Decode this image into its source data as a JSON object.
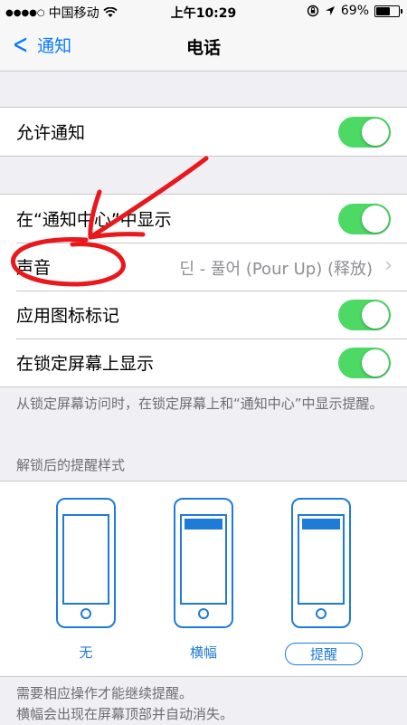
{
  "status_bar": {
    "signal_dots": "●●●●○",
    "carrier": "中国移动",
    "time": "上午10:29",
    "battery_percent_text": "69%",
    "battery_level": 0.69
  },
  "nav": {
    "back_label": "通知",
    "title": "电话"
  },
  "allow_group": {
    "allow_label": "允许通知",
    "allow_on": true
  },
  "settings_group": {
    "notification_center_label": "在“通知中心”中显示",
    "sound_label": "声音",
    "sound_value": "딘 - 풀어 (Pour Up) (释放)",
    "badge_label": "应用图标标记",
    "lock_screen_label": "在锁定屏幕上显示"
  },
  "lock_note": "从锁定屏幕访问时，在锁定屏幕上和“通知中心”中显示提醒。",
  "alert_style_header": "解锁后的提醒样式",
  "alert_styles": {
    "none_label": "无",
    "banner_label": "横幅",
    "alert_label": "提醒",
    "selected": "提醒"
  },
  "footer_note": {
    "line1": "需要相应操作才能继续提醒。",
    "line2": "横幅会出现在屏幕顶部并自动消失。"
  },
  "colors": {
    "accent": "#0a7aff",
    "switch_on": "#4cd964",
    "annotation": "#e8181c"
  }
}
